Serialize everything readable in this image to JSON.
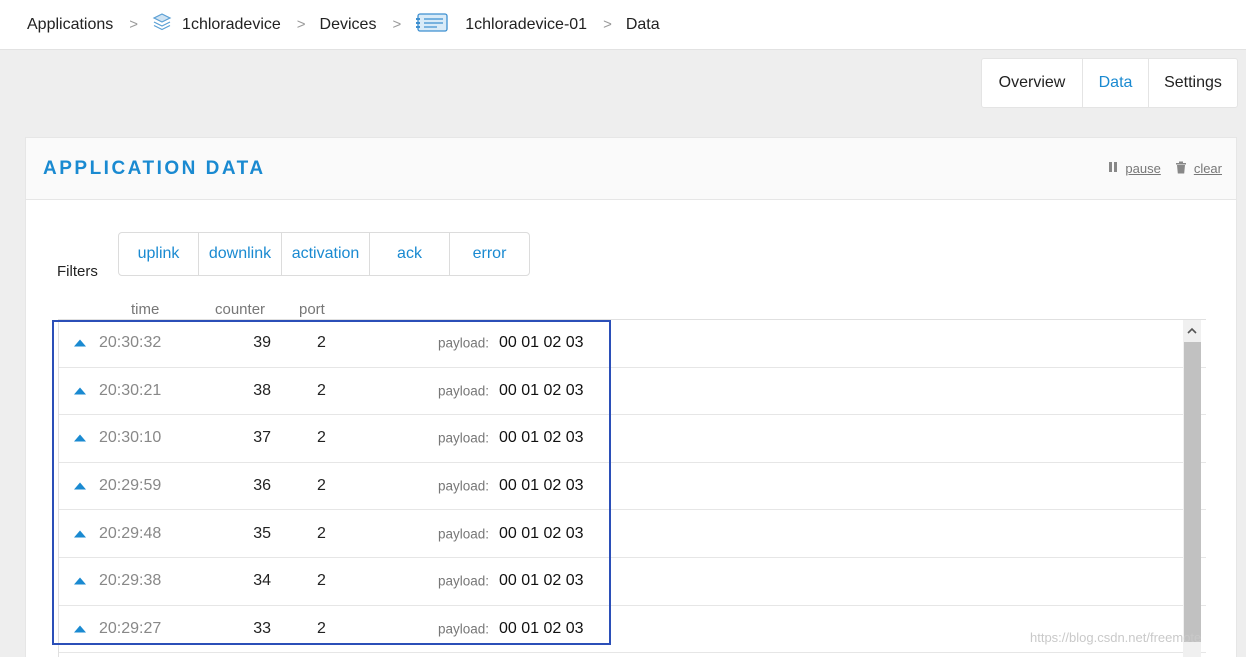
{
  "breadcrumb": {
    "items": [
      {
        "label": "Applications",
        "icon": ""
      },
      {
        "label": "1chloradevice",
        "icon": "layers-icon"
      },
      {
        "label": "Devices",
        "icon": ""
      },
      {
        "label": "1chloradevice-01",
        "icon": "device-icon"
      },
      {
        "label": "Data",
        "icon": ""
      }
    ],
    "separator": ">"
  },
  "tabs": [
    {
      "label": "Overview",
      "active": false
    },
    {
      "label": "Data",
      "active": true
    },
    {
      "label": "Settings",
      "active": false
    }
  ],
  "card": {
    "title": "APPLICATION DATA",
    "pause_label": "pause",
    "clear_label": "clear"
  },
  "filters": {
    "label": "Filters",
    "items": [
      "uplink",
      "downlink",
      "activation",
      "ack",
      "error"
    ]
  },
  "columns": {
    "time": "time",
    "counter": "counter",
    "port": "port"
  },
  "rows": [
    {
      "time": "20:30:32",
      "counter": "39",
      "port": "2",
      "payload_label": "payload:",
      "payload": "00 01 02 03"
    },
    {
      "time": "20:30:21",
      "counter": "38",
      "port": "2",
      "payload_label": "payload:",
      "payload": "00 01 02 03"
    },
    {
      "time": "20:30:10",
      "counter": "37",
      "port": "2",
      "payload_label": "payload:",
      "payload": "00 01 02 03"
    },
    {
      "time": "20:29:59",
      "counter": "36",
      "port": "2",
      "payload_label": "payload:",
      "payload": "00 01 02 03"
    },
    {
      "time": "20:29:48",
      "counter": "35",
      "port": "2",
      "payload_label": "payload:",
      "payload": "00 01 02 03"
    },
    {
      "time": "20:29:38",
      "counter": "34",
      "port": "2",
      "payload_label": "payload:",
      "payload": "00 01 02 03"
    },
    {
      "time": "20:29:27",
      "counter": "33",
      "port": "2",
      "payload_label": "payload:",
      "payload": "00 01 02 03"
    }
  ],
  "watermark": "https://blog.csdn.net/freemote",
  "colors": {
    "accent": "#1a8ad1",
    "highlight": "#2b4fb8",
    "background": "#eeeeee"
  }
}
